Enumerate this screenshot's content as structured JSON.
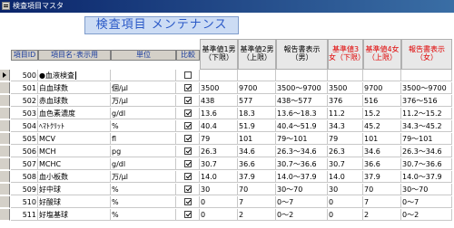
{
  "window": {
    "title": "検査項目マスタ"
  },
  "form": {
    "banner": "検査項目 メンテナンス"
  },
  "columns": [
    {
      "key": "id",
      "label": "項目ID",
      "style": "simple"
    },
    {
      "key": "name",
      "label": "項目名･表示用",
      "style": "simple"
    },
    {
      "key": "unit",
      "label": "単位",
      "style": "simple"
    },
    {
      "key": "compare",
      "label": "比較",
      "style": "simple"
    },
    {
      "key": "m_low",
      "label": "基準値1男（下限）",
      "style": "blk"
    },
    {
      "key": "m_high",
      "label": "基準値2男（上限）",
      "style": "blk"
    },
    {
      "key": "m_disp",
      "label": "報告書表示（男）",
      "style": "blk"
    },
    {
      "key": "f_low",
      "label": "基準値3女（下限）",
      "style": "red"
    },
    {
      "key": "f_high",
      "label": "基準値4女（上限）",
      "style": "red"
    },
    {
      "key": "f_disp",
      "label": "報告書表示（女）",
      "style": "red"
    }
  ],
  "rows": [
    {
      "id": "500",
      "name": "●血液検査",
      "unit": "",
      "compare": false,
      "m_low": "",
      "m_high": "",
      "m_disp": "",
      "f_low": "",
      "f_high": "",
      "f_disp": "",
      "current": true
    },
    {
      "id": "501",
      "name": "白血球数",
      "unit": "個/μl",
      "compare": true,
      "m_low": "3500",
      "m_high": "9700",
      "m_disp": "3500〜9700",
      "f_low": "3500",
      "f_high": "9700",
      "f_disp": "3500〜9700"
    },
    {
      "id": "502",
      "name": "赤血球数",
      "unit": "万/μl",
      "compare": true,
      "m_low": "438",
      "m_high": "577",
      "m_disp": "438〜577",
      "f_low": "376",
      "f_high": "516",
      "f_disp": "376〜516"
    },
    {
      "id": "503",
      "name": "血色素濃度",
      "unit": "g/dl",
      "compare": true,
      "m_low": "13.6",
      "m_high": "18.3",
      "m_disp": "13.6〜18.3",
      "f_low": "11.2",
      "f_high": "15.2",
      "f_disp": "11.2〜15.2"
    },
    {
      "id": "504",
      "name": "ﾍﾏﾄｸﾘｯﾄ",
      "unit": "%",
      "compare": true,
      "m_low": "40.4",
      "m_high": "51.9",
      "m_disp": "40.4〜51.9",
      "f_low": "34.3",
      "f_high": "45.2",
      "f_disp": "34.3〜45.2"
    },
    {
      "id": "505",
      "name": "MCV",
      "unit": "fl",
      "compare": true,
      "m_low": "79",
      "m_high": "101",
      "m_disp": "79〜101",
      "f_low": "79",
      "f_high": "101",
      "f_disp": "79〜101"
    },
    {
      "id": "506",
      "name": "MCH",
      "unit": "pg",
      "compare": true,
      "m_low": "26.3",
      "m_high": "34.6",
      "m_disp": "26.3〜34.6",
      "f_low": "26.3",
      "f_high": "34.6",
      "f_disp": "26.3〜34.6"
    },
    {
      "id": "507",
      "name": "MCHC",
      "unit": "g/dl",
      "compare": true,
      "m_low": "30.7",
      "m_high": "36.6",
      "m_disp": "30.7〜36.6",
      "f_low": "30.7",
      "f_high": "36.6",
      "f_disp": "30.7〜36.6"
    },
    {
      "id": "508",
      "name": "血小板数",
      "unit": "万/μl",
      "compare": true,
      "m_low": "14.0",
      "m_high": "37.9",
      "m_disp": "14.0〜37.9",
      "f_low": "14.0",
      "f_high": "37.9",
      "f_disp": "14.0〜37.9"
    },
    {
      "id": "509",
      "name": "好中球",
      "unit": "%",
      "compare": true,
      "m_low": "30",
      "m_high": "70",
      "m_disp": "30〜70",
      "f_low": "30",
      "f_high": "70",
      "f_disp": "30〜70"
    },
    {
      "id": "510",
      "name": "好酸球",
      "unit": "%",
      "compare": true,
      "m_low": "0",
      "m_high": "7",
      "m_disp": "0〜7",
      "f_low": "0",
      "f_high": "7",
      "f_disp": "0〜7"
    },
    {
      "id": "511",
      "name": "好塩基球",
      "unit": "%",
      "compare": true,
      "m_low": "0",
      "m_high": "2",
      "m_disp": "0〜2",
      "f_low": "0",
      "f_high": "2",
      "f_disp": "0〜2"
    }
  ]
}
